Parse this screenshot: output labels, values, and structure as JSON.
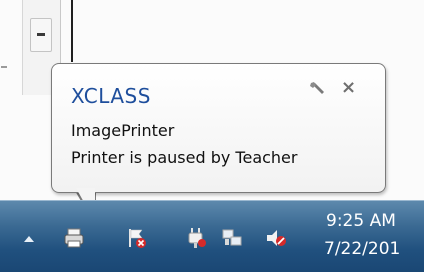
{
  "balloon": {
    "title": "XCLASS",
    "line1": "ImagePrinter",
    "line2": "Printer is paused by Teacher",
    "options_icon": "wrench-icon",
    "close_icon": "close-icon",
    "close_glyph": "×"
  },
  "tray": {
    "icons": [
      "show-hidden-icons-arrow",
      "printer-icon",
      "action-center-flag-icon",
      "power-plug-icon",
      "network-icon",
      "volume-muted-icon"
    ]
  },
  "clock": {
    "time": "9:25 AM",
    "date": "7/22/201"
  },
  "colors": {
    "title": "#1e4e9c",
    "taskbar": "#2a5a88"
  }
}
